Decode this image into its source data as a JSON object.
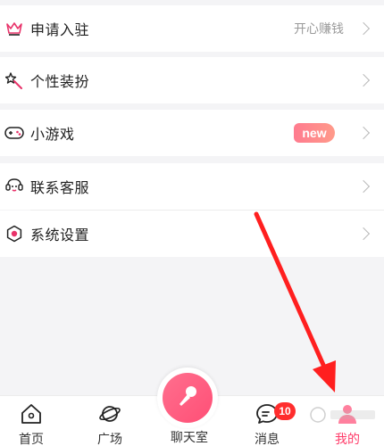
{
  "menu": {
    "items": [
      {
        "label": "申请入驻",
        "sub": "开心赚钱",
        "icon": "crown-icon"
      },
      {
        "label": "个性装扮",
        "icon": "magic-wand-icon"
      },
      {
        "label": "小游戏",
        "badge": "new",
        "icon": "gamepad-icon"
      },
      {
        "label": "联系客服",
        "icon": "customer-service-icon"
      },
      {
        "label": "系统设置",
        "icon": "settings-icon"
      }
    ]
  },
  "tabbar": {
    "tabs": [
      {
        "label": "首页",
        "icon": "home-icon"
      },
      {
        "label": "广场",
        "icon": "planet-icon"
      },
      {
        "label": "聊天室",
        "icon": "microphone-icon"
      },
      {
        "label": "消息",
        "icon": "message-icon",
        "badge": "10"
      },
      {
        "label": "我的",
        "icon": "profile-icon",
        "active": true
      }
    ]
  },
  "colors": {
    "accent": "#ff3d6a",
    "arrow": "#ff1f1f",
    "background": "#f4f4f6"
  }
}
